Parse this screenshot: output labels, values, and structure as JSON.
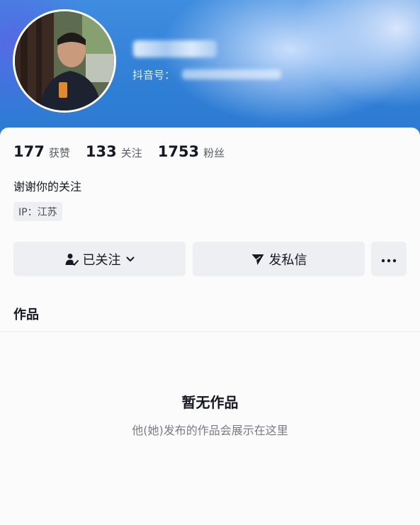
{
  "profile": {
    "id_label": "抖音号：",
    "avatar_desc": "avatar"
  },
  "stats": [
    {
      "count": "177",
      "label": "获赞"
    },
    {
      "count": "133",
      "label": "关注"
    },
    {
      "count": "1753",
      "label": "粉丝"
    }
  ],
  "bio": "谢谢你的关注",
  "ip": "IP：江苏",
  "actions": {
    "follow_label": "已关注",
    "message_label": "发私信",
    "more_label": "···"
  },
  "tabs": {
    "works_label": "作品"
  },
  "empty_state": {
    "title": "暂无作品",
    "subtitle": "他(她)发布的作品会展示在这里"
  },
  "colors": {
    "header_blue": "#2f7fd6",
    "button_bg": "#eeeff2",
    "text_primary": "#161823",
    "text_secondary": "#7a7c85"
  },
  "icons": [
    "follow-check-user-icon",
    "chevron-down-icon",
    "send-message-icon",
    "more-dots-icon"
  ]
}
